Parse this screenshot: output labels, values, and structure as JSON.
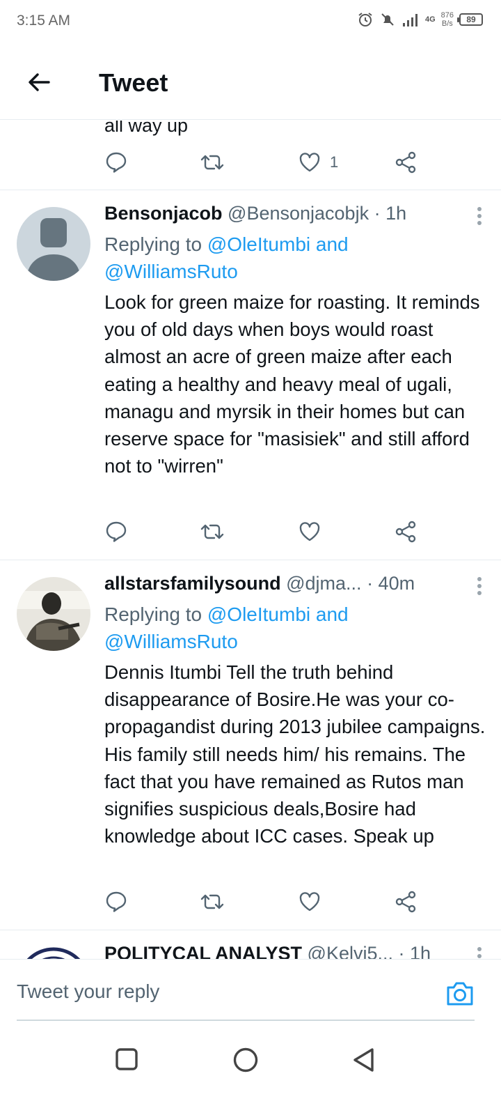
{
  "status": {
    "time": "3:15 AM",
    "netspeed_value": "876",
    "netspeed_unit": "B/s",
    "network": "4G",
    "battery": "89"
  },
  "header": {
    "title": "Tweet"
  },
  "previous_tweet": {
    "text_tail": "all way up",
    "like_count": "1"
  },
  "tweets": [
    {
      "display_name": "Bensonjacob",
      "handle": "@Bensonjacobjk",
      "time": "· 1h",
      "replying_prefix": "Replying to ",
      "replying_mentions": "@OleItumbi and",
      "replying_mentions_2": "@WilliamsRuto",
      "text": "Look for green maize for roasting. It reminds you of old days when boys would roast almost an acre of green maize after each eating a healthy and heavy meal of ugali, managu and myrsik in their homes but can reserve space for \"masisiek\" and still afford not to \"wirren\""
    },
    {
      "display_name": "allstarsfamilysound",
      "handle": "@djma...",
      "time": "· 40m",
      "replying_prefix": "Replying to ",
      "replying_mentions": "@OleItumbi and",
      "replying_mentions_2": "@WilliamsRuto",
      "text": "Dennis Itumbi Tell the truth behind disappearance of Bosire.He was your co-propagandist during 2013 jubilee campaigns. His family still needs him/ his remains. The fact that you have remained as Rutos man signifies suspicious deals,Bosire had knowledge about ICC cases. Speak up"
    },
    {
      "display_name": "POLITYCAL ANALYST",
      "handle": "@Kelvi5...",
      "time": "· 1h"
    }
  ],
  "reply_bar": {
    "placeholder": "Tweet your reply"
  },
  "colors": {
    "accent": "#1d9bf0",
    "text": "#0f1419",
    "muted": "#536471",
    "divider": "#e6ecf0"
  },
  "icons": {
    "back": "arrow-left-icon",
    "reply": "comment-icon",
    "retweet": "retweet-icon",
    "like": "heart-icon",
    "share": "share-icon",
    "more": "more-vertical-icon",
    "camera": "camera-icon",
    "nav": [
      "square-icon",
      "circle-icon",
      "triangle-back-icon"
    ]
  }
}
